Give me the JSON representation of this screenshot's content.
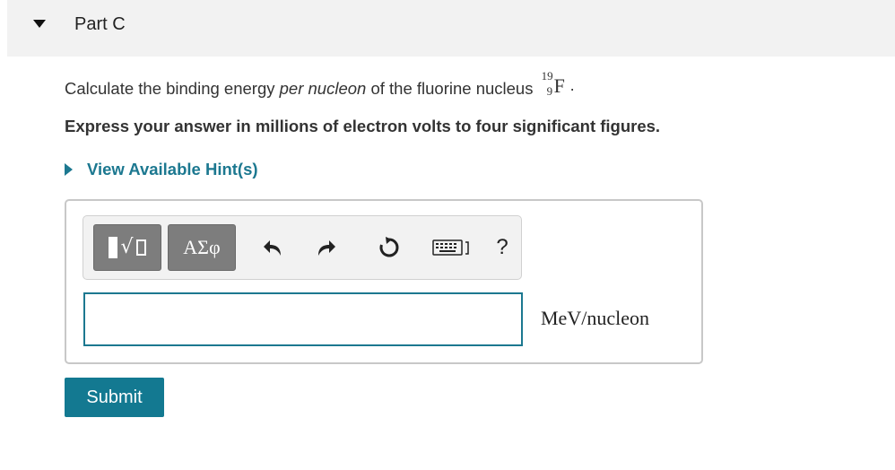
{
  "part": {
    "title": "Part C"
  },
  "question": {
    "prefix": "Calculate the binding energy ",
    "emphasis": "per nucleon",
    "suffix": " of the fluorine nucleus ",
    "nuclide_mass": "19",
    "nuclide_atomic": "9",
    "nuclide_symbol": "F",
    "period": "."
  },
  "instruction": "Express your answer in millions of electron volts to four significant figures.",
  "hint": {
    "label": "View Available Hint(s)"
  },
  "toolbar": {
    "symbols_label": "ΑΣφ",
    "help_label": "?",
    "icons": [
      "templates-icon",
      "undo-icon",
      "redo-icon",
      "reset-icon",
      "keyboard-icon",
      "help-icon"
    ]
  },
  "answer": {
    "value": "",
    "unit": "MeV/nucleon"
  },
  "submit": {
    "label": "Submit"
  },
  "colors": {
    "accent": "#137991",
    "header_bg": "#f2f2f2",
    "tool_bg": "#7d7d7d"
  }
}
